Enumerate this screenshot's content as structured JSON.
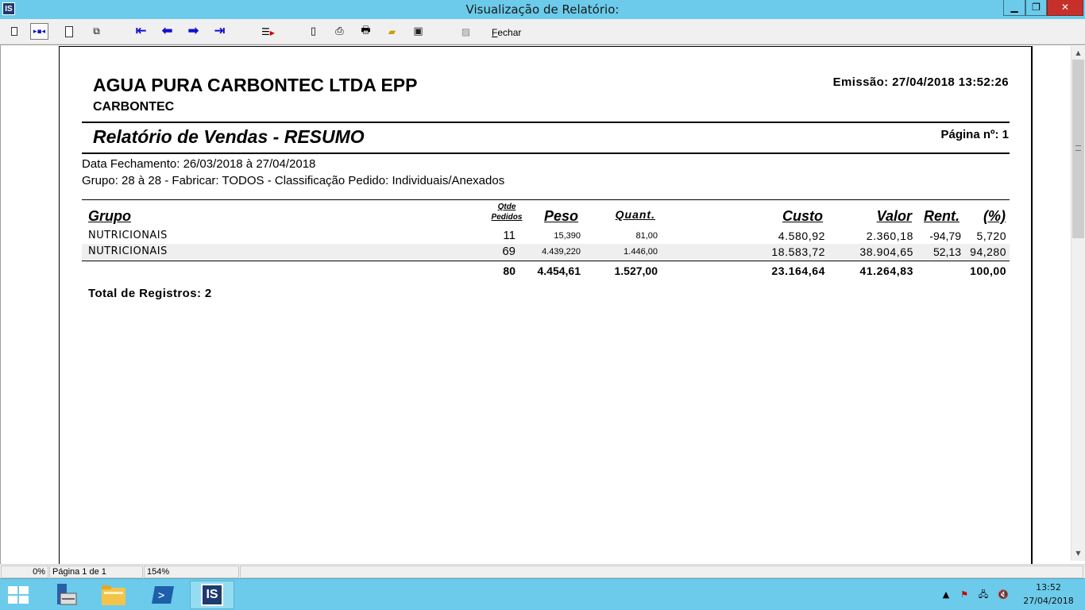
{
  "window": {
    "title": "Visualização de Relatório:",
    "app_icon_text": "IS",
    "minimize_glyph": "▁",
    "maximize_glyph": "❐",
    "close_glyph": "✕"
  },
  "toolbar": {
    "fechar_label": "Fechar",
    "buttons": [
      "page-single-icon",
      "page-width-icon",
      "page-whole-icon",
      "multi-page-icon",
      "first-page-icon",
      "prev-page-icon",
      "next-page-icon",
      "last-page-icon",
      "goto-page-icon",
      "copy-page-icon",
      "print-setup-icon",
      "print-icon",
      "open-icon",
      "save-icon",
      "export-icon"
    ]
  },
  "report": {
    "company": "AGUA PURA CARBONTEC LTDA EPP",
    "subtitle": "CARBONTEC",
    "emissao": "Emissão: 27/04/2018 13:52:26",
    "title": "Relatório de Vendas - RESUMO",
    "pagina": "Página nº: 1",
    "filter_line1": "Data Fechamento: 26/03/2018 à 27/04/2018",
    "filter_line2": "Grupo: 28 à 28 - Fabricar: TODOS - Classificação Pedido: Individuais/Anexados",
    "columns": {
      "grupo": "Grupo",
      "qtde_pedidos": "Qtde Pedidos",
      "peso": "Peso",
      "quant": "Quant.",
      "custo": "Custo",
      "valor": "Valor",
      "rent": "Rent.",
      "pct": "(%)"
    },
    "rows": [
      {
        "grupo": "NUTRICIONAIS",
        "qtde": "11",
        "peso": "15,390",
        "quant": "81,00",
        "custo": "4.580,92",
        "valor": "2.360,18",
        "rent": "-94,79",
        "pct": "5,720"
      },
      {
        "grupo": "NUTRICIONAIS",
        "qtde": "69",
        "peso": "4.439,220",
        "quant": "1.446,00",
        "custo": "18.583,72",
        "valor": "38.904,65",
        "rent": "52,13",
        "pct": "94,280"
      }
    ],
    "totals": {
      "qtde": "80",
      "peso": "4.454,61",
      "quant": "1.527,00",
      "custo": "23.164,64",
      "valor": "41.264,83",
      "pct": "100,00"
    },
    "total_registros": "Total de Registros: 2"
  },
  "statusbar": {
    "progress": "0%",
    "page": "Página 1 de 1",
    "zoom": "154%"
  },
  "taskbar": {
    "apps": [
      "server-manager-icon",
      "file-explorer-icon",
      "powershell-icon",
      "is-app-icon"
    ],
    "active_app_text": "IS",
    "time": "13:52",
    "date": "27/04/2018"
  },
  "colors": {
    "titlebar": "#6ccbea",
    "close_button": "#c7302a",
    "toolbar_arrows": "#1010d0",
    "row_alt": "#efefef"
  }
}
